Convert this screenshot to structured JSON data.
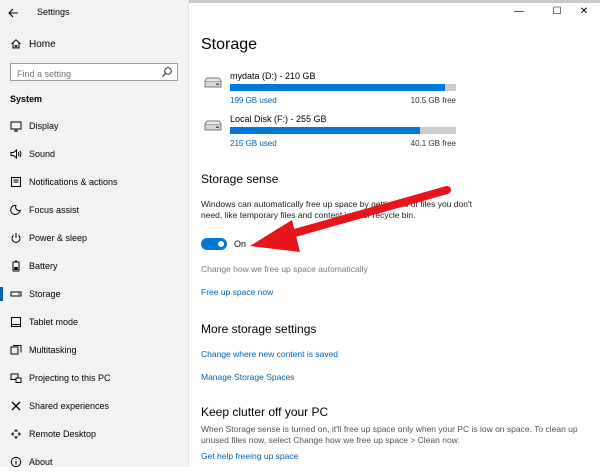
{
  "window": {
    "title": "Settings",
    "controls": {
      "minimize": "—",
      "maximize": "☐",
      "close": "✕"
    }
  },
  "sidebar": {
    "home_label": "Home",
    "search_placeholder": "Find a setting",
    "section": "System",
    "items": [
      {
        "label": "Display",
        "icon": "display-icon",
        "active": false
      },
      {
        "label": "Sound",
        "icon": "sound-icon",
        "active": false
      },
      {
        "label": "Notifications & actions",
        "icon": "notifications-icon",
        "active": false
      },
      {
        "label": "Focus assist",
        "icon": "focus-assist-icon",
        "active": false
      },
      {
        "label": "Power & sleep",
        "icon": "power-icon",
        "active": false
      },
      {
        "label": "Battery",
        "icon": "battery-icon",
        "active": false
      },
      {
        "label": "Storage",
        "icon": "storage-icon",
        "active": true
      },
      {
        "label": "Tablet mode",
        "icon": "tablet-icon",
        "active": false
      },
      {
        "label": "Multitasking",
        "icon": "multitasking-icon",
        "active": false
      },
      {
        "label": "Projecting to this PC",
        "icon": "projecting-icon",
        "active": false
      },
      {
        "label": "Shared experiences",
        "icon": "shared-experiences-icon",
        "active": false
      },
      {
        "label": "Remote Desktop",
        "icon": "remote-desktop-icon",
        "active": false
      },
      {
        "label": "About",
        "icon": "about-icon",
        "active": false
      }
    ]
  },
  "main": {
    "title": "Storage",
    "drives": [
      {
        "name": "mydata (D:) - 210 GB",
        "used_label": "199 GB used",
        "free_label": "10.5 GB free",
        "used_fraction": 0.95
      },
      {
        "name": "Local Disk (F:) - 255 GB",
        "used_label": "215 GB used",
        "free_label": "40.1 GB free",
        "used_fraction": 0.84
      }
    ],
    "storage_sense": {
      "heading": "Storage sense",
      "description": "Windows can automatically free up space by getting rid of files you don't need, like temporary files and content in your recycle bin.",
      "toggle_label": "On",
      "toggle_on": true,
      "change_link": "Change how we free up space automatically",
      "free_up_link": "Free up space now"
    },
    "more_settings": {
      "heading": "More storage settings",
      "link1": "Change where new content is saved",
      "link2": "Manage Storage Spaces"
    },
    "keep_clutter": {
      "heading": "Keep clutter off your PC",
      "description": "When Storage sense is turned on, it'll free up space only when your PC is low on space. To clean up unused files now, select Change how we free up space > Clean now.",
      "link": "Get help freeing up space"
    }
  },
  "colors": {
    "accent": "#0078d7",
    "link": "#0063b1",
    "arrow": "#e8141c",
    "bar_bg": "#cccccc"
  }
}
